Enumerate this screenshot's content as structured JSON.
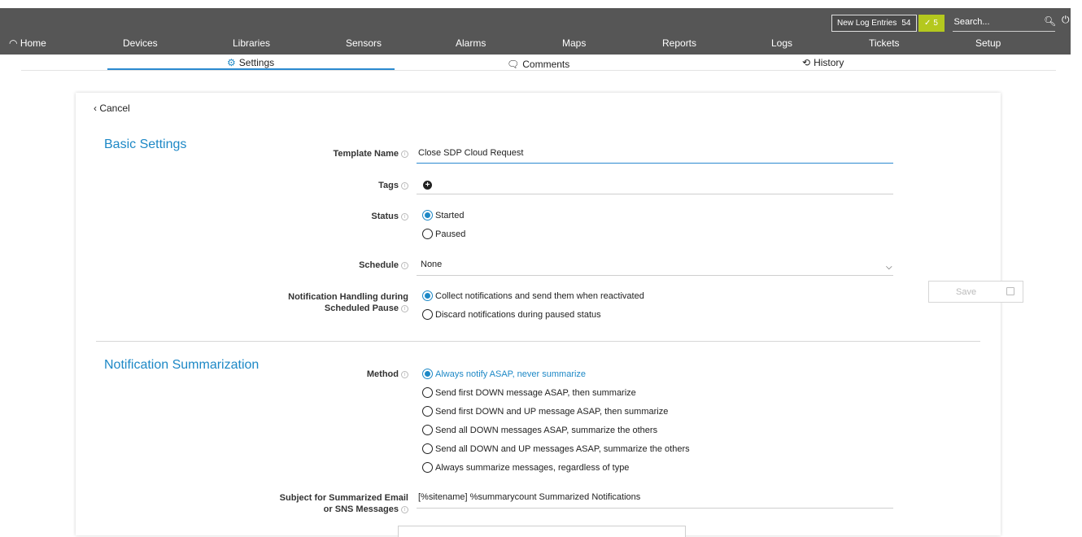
{
  "header": {
    "log_label": "New Log Entries",
    "log_count": "54",
    "check_count": "5",
    "search_placeholder": "Search..."
  },
  "nav": {
    "items": [
      "Home",
      "Devices",
      "Libraries",
      "Sensors",
      "Alarms",
      "Maps",
      "Reports",
      "Logs",
      "Tickets",
      "Setup"
    ]
  },
  "tabs": {
    "settings": "Settings",
    "comments": "Comments",
    "history": "History"
  },
  "form": {
    "cancel": "Cancel",
    "basic_title": "Basic Settings",
    "template_name_label": "Template Name",
    "template_name_value": "Close SDP Cloud Request",
    "tags_label": "Tags",
    "status_label": "Status",
    "status_options": [
      "Started",
      "Paused"
    ],
    "schedule_label": "Schedule",
    "schedule_value": "None",
    "notif_handling_label_1": "Notification Handling during",
    "notif_handling_label_2": "Scheduled Pause",
    "notif_handling_options": [
      "Collect notifications and send them when reactivated",
      "Discard notifications during paused status"
    ],
    "summarization_title": "Notification Summarization",
    "method_label": "Method",
    "method_options": [
      "Always notify ASAP, never summarize",
      "Send first DOWN message ASAP, then summarize",
      "Send first DOWN and UP message ASAP, then summarize",
      "Send all DOWN messages ASAP, summarize the others",
      "Send all DOWN and UP messages ASAP, summarize the others",
      "Always summarize messages, regardless of type"
    ],
    "subject_label_1": "Subject for Summarized Email",
    "subject_label_2": "or SNS Messages",
    "subject_value": "[%sitename] %summarycount Summarized Notifications",
    "save": "Save"
  }
}
